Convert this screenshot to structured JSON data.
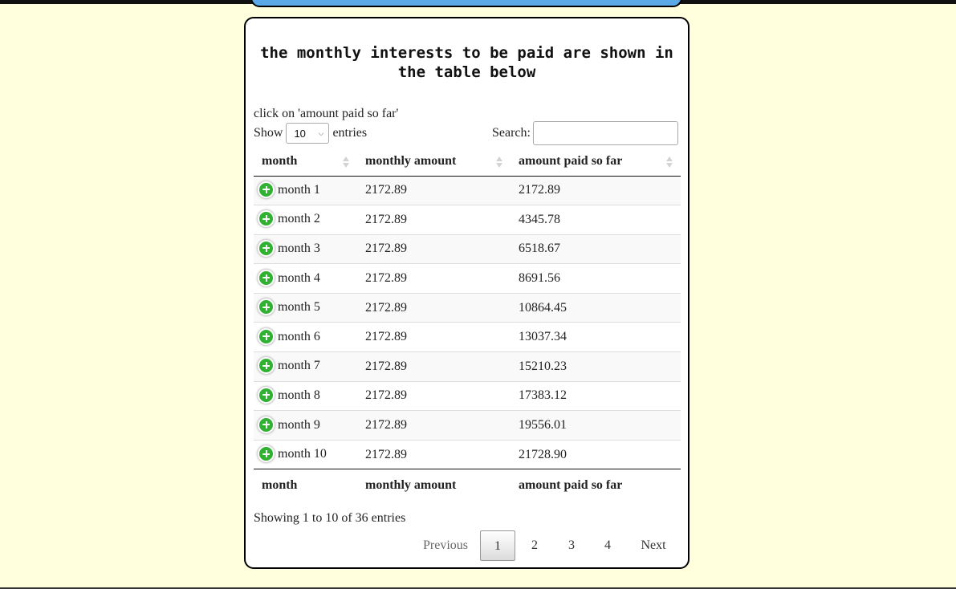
{
  "card": {
    "title": "the monthly interests to be paid are shown in the table below",
    "hint": "click on 'amount paid so far'"
  },
  "controls": {
    "show_label": "Show",
    "entries_value": "10",
    "entries_label": "entries",
    "search_label": "Search:",
    "search_value": ""
  },
  "table": {
    "columns": [
      "month",
      "monthly amount",
      "amount paid so far"
    ],
    "rows": [
      [
        "month 1",
        "2172.89",
        "2172.89"
      ],
      [
        "month 2",
        "2172.89",
        "4345.78"
      ],
      [
        "month 3",
        "2172.89",
        "6518.67"
      ],
      [
        "month 4",
        "2172.89",
        "8691.56"
      ],
      [
        "month 5",
        "2172.89",
        "10864.45"
      ],
      [
        "month 6",
        "2172.89",
        "13037.34"
      ],
      [
        "month 7",
        "2172.89",
        "15210.23"
      ],
      [
        "month 8",
        "2172.89",
        "17383.12"
      ],
      [
        "month 9",
        "2172.89",
        "19556.01"
      ],
      [
        "month 10",
        "2172.89",
        "21728.90"
      ]
    ]
  },
  "info": "Showing 1 to 10 of 36 entries",
  "pagination": {
    "previous": "Previous",
    "pages": [
      "1",
      "2",
      "3",
      "4"
    ],
    "current": "1",
    "next": "Next"
  }
}
